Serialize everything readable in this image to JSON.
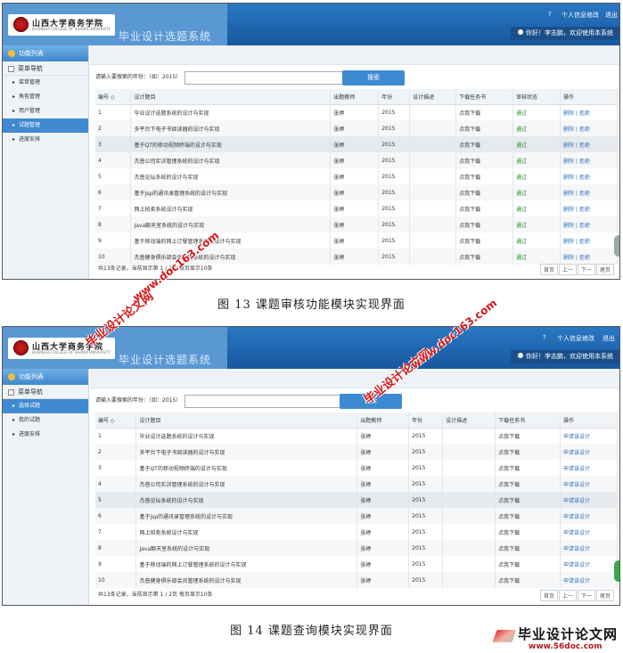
{
  "header": {
    "school_name": "山西大学商务学院",
    "school_name_en": "BUSINESS COLLEGE OF SHANXI UNIVERSITY",
    "system_title": "毕业设计选题系统",
    "help_icon": "question-icon",
    "help_label": "?",
    "profile_label": "个人信息修改",
    "logout_label": "退出",
    "welcome": "你好！李志鹏，欢迎使用本系统"
  },
  "sidebar": {
    "section_label": "功能列表",
    "nav_title": "菜单导航"
  },
  "screen1": {
    "nav_items": [
      "菜单管理",
      "角色管理",
      "用户管理",
      "试题管理",
      "进度安排"
    ],
    "columns": [
      "编号 ◇",
      "设计题目",
      "出题教师",
      "年份",
      "设计描述",
      "下载任务书",
      "审核状态",
      "操作"
    ],
    "rows": [
      {
        "id": "1",
        "title": "毕业设计选题系统的设计与实现",
        "teacher": "张婷",
        "year": "2015",
        "desc": "",
        "download": "点我下载",
        "status": "通过",
        "action": "删除 | 拒绝"
      },
      {
        "id": "2",
        "title": "多平台下电子书阅读器的设计与实现",
        "teacher": "张婷",
        "year": "2015",
        "desc": "",
        "download": "点我下载",
        "status": "通过",
        "action": "删除 | 拒绝"
      },
      {
        "id": "3",
        "title": "基于QT的移动视频终端的设计与实现",
        "teacher": "张婷",
        "year": "2015",
        "desc": "",
        "download": "点我下载",
        "status": "通过",
        "action": "删除 | 拒绝"
      },
      {
        "id": "4",
        "title": "杰普公司实训管理系统的设计与实现",
        "teacher": "张婷",
        "year": "2015",
        "desc": "",
        "download": "点我下载",
        "status": "通过",
        "action": "删除 | 拒绝"
      },
      {
        "id": "5",
        "title": "杰普论坛系统的设计与实现",
        "teacher": "张婷",
        "year": "2015",
        "desc": "",
        "download": "点我下载",
        "status": "通过",
        "action": "删除 | 拒绝"
      },
      {
        "id": "6",
        "title": "基于jsp的通讯录管理系统的设计与实现",
        "teacher": "张婷",
        "year": "2015",
        "desc": "",
        "download": "点我下载",
        "status": "通过",
        "action": "删除 | 拒绝"
      },
      {
        "id": "7",
        "title": "网上拍卖系统设计与实现",
        "teacher": "张婷",
        "year": "2015",
        "desc": "",
        "download": "点我下载",
        "status": "通过",
        "action": "删除 | 拒绝"
      },
      {
        "id": "8",
        "title": "Java聊天室系统的设计与实现",
        "teacher": "张婷",
        "year": "2015",
        "desc": "",
        "download": "点我下载",
        "status": "通过",
        "action": "删除 | 拒绝"
      },
      {
        "id": "9",
        "title": "基于移动端的网上订餐管理系统的设计与实现",
        "teacher": "张婷",
        "year": "2015",
        "desc": "",
        "download": "点我下载",
        "status": "通过",
        "action": "删除 | 拒绝"
      },
      {
        "id": "10",
        "title": "杰普健身俱乐部会员管理系统的设计与实现",
        "teacher": "张婷",
        "year": "2015",
        "desc": "",
        "download": "点我下载",
        "status": "通过",
        "action": "删除 | 拒绝"
      }
    ],
    "caption": "图 13    课题审核功能模块实现界面"
  },
  "screen2": {
    "nav_items": [
      "选择试题",
      "我的试题",
      "进度安排"
    ],
    "columns": [
      "编号 ◇",
      "设计题目",
      "出题教师",
      "年份",
      "设计描述",
      "下载任务书",
      "操作"
    ],
    "rows": [
      {
        "id": "1",
        "title": "毕业设计选题系统的设计与实现",
        "teacher": "张婷",
        "year": "2015",
        "desc": "",
        "download": "点我下载",
        "action": "申请该设计"
      },
      {
        "id": "2",
        "title": "多平台下电子书阅读器的设计与实现",
        "teacher": "张婷",
        "year": "2015",
        "desc": "",
        "download": "点我下载",
        "action": "申请该设计"
      },
      {
        "id": "3",
        "title": "基于QT的移动视频终端的设计与实现",
        "teacher": "张婷",
        "year": "2015",
        "desc": "",
        "download": "点我下载",
        "action": "申请该设计"
      },
      {
        "id": "4",
        "title": "杰普公司实训管理系统的设计与实现",
        "teacher": "张婷",
        "year": "2015",
        "desc": "",
        "download": "点我下载",
        "action": "申请该设计"
      },
      {
        "id": "5",
        "title": "杰普论坛系统的设计与实现",
        "teacher": "张婷",
        "year": "2015",
        "desc": "",
        "download": "点我下载",
        "action": "申请该设计"
      },
      {
        "id": "6",
        "title": "基于jsp的通讯录管理系统的设计与实现",
        "teacher": "张婷",
        "year": "2015",
        "desc": "",
        "download": "点我下载",
        "action": "申请该设计"
      },
      {
        "id": "7",
        "title": "网上拍卖系统设计与实现",
        "teacher": "张婷",
        "year": "2015",
        "desc": "",
        "download": "点我下载",
        "action": "申请该设计"
      },
      {
        "id": "8",
        "title": "Java聊天室系统的设计与实现",
        "teacher": "张婷",
        "year": "2015",
        "desc": "",
        "download": "点我下载",
        "action": "申请该设计"
      },
      {
        "id": "9",
        "title": "基于移动端的网上订餐管理系统的设计与实现",
        "teacher": "张婷",
        "year": "2015",
        "desc": "",
        "download": "点我下载",
        "action": "申请该设计"
      },
      {
        "id": "10",
        "title": "杰普健身俱乐部会员管理系统的设计与实现",
        "teacher": "张婷",
        "year": "2015",
        "desc": "",
        "download": "点我下载",
        "action": "申请该设计"
      }
    ],
    "caption": "图 14    课题查询模块实现界面"
  },
  "search": {
    "label": "请输入要搜索的年份：（如：2015）",
    "button": "搜索"
  },
  "footer": {
    "info": "共13条记录，当前显示第 1 / 2页 每页显示10条",
    "pager": [
      "首页",
      "上一",
      "下一",
      "尾页"
    ]
  },
  "watermark": {
    "text_cn": "毕业设计论文网",
    "text_url": "www.doc163.com",
    "corner_cn": "毕业设计论文网",
    "corner_url": "www.56doc.com"
  },
  "colors": {
    "header_blue": "#1d5ea8",
    "accent_blue": "#3d8ad3",
    "pass_green": "#2a8a2a",
    "watermark_red": "#d41616"
  }
}
